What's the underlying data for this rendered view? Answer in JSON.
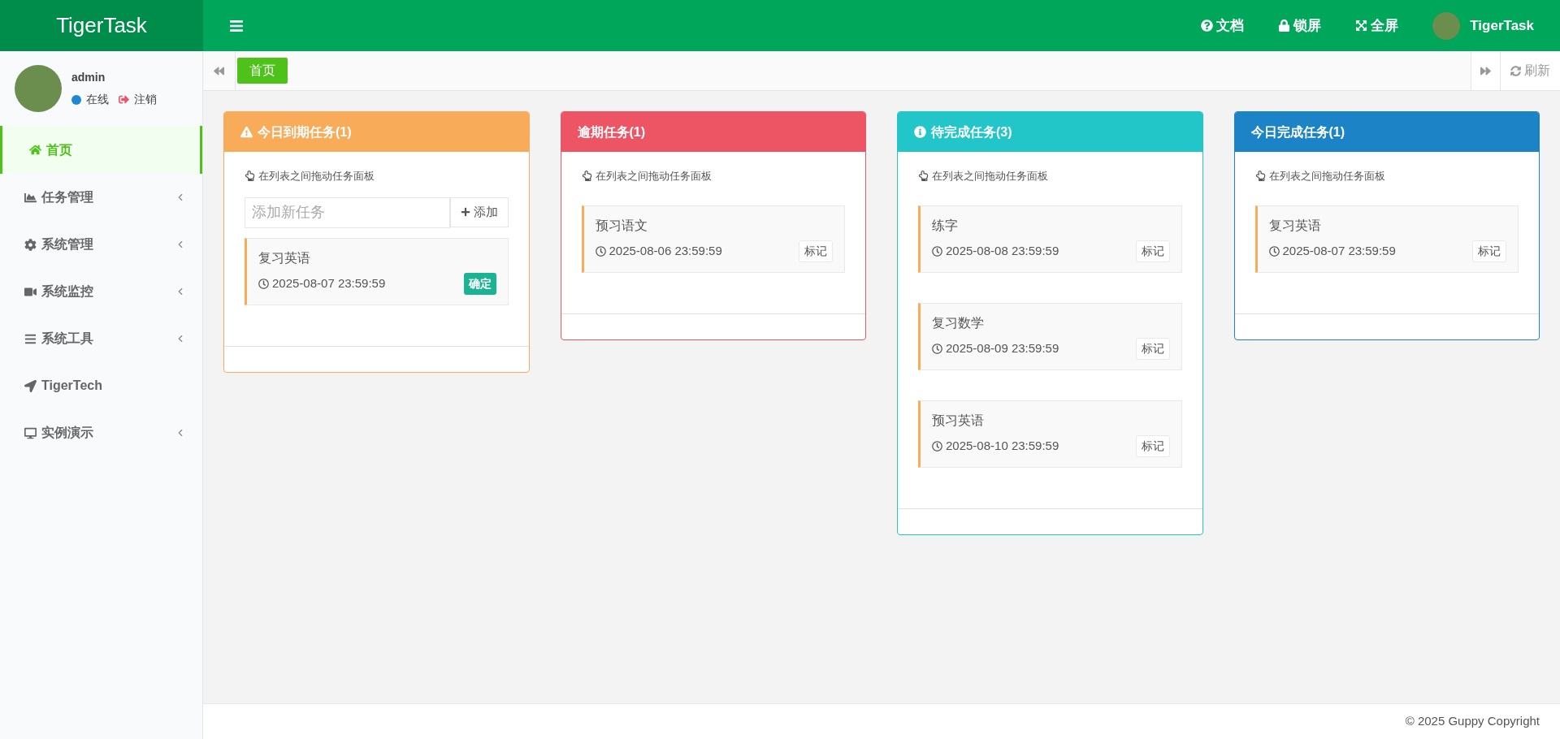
{
  "brand": "TigerTask",
  "header": {
    "links": [
      {
        "kind": "help",
        "label": "文档"
      },
      {
        "kind": "lock",
        "label": "锁屏"
      },
      {
        "kind": "fullscreen",
        "label": "全屏"
      }
    ],
    "user": "TigerTask"
  },
  "sidebar": {
    "user": {
      "name": "admin",
      "status": "在线",
      "logout": "注销"
    },
    "items": [
      {
        "kind": "home",
        "label": "首页",
        "selected": true,
        "has_children": false
      },
      {
        "kind": "tasks",
        "label": "任务管理",
        "selected": false,
        "has_children": true
      },
      {
        "kind": "system",
        "label": "系统管理",
        "selected": false,
        "has_children": true
      },
      {
        "kind": "monitor",
        "label": "系统监控",
        "selected": false,
        "has_children": true
      },
      {
        "kind": "tools",
        "label": "系统工具",
        "selected": false,
        "has_children": true
      },
      {
        "kind": "link",
        "label": "TigerTech",
        "selected": false,
        "has_children": false
      },
      {
        "kind": "demo",
        "label": "实例演示",
        "selected": false,
        "has_children": true
      }
    ]
  },
  "tabs": [
    {
      "label": "首页",
      "selected": true
    }
  ],
  "refresh": "刷新",
  "columns": [
    {
      "title": "今日到期任务(1)",
      "kind": "warning",
      "color": "#f8ac59",
      "hint": "在列表之间拖动任务面板",
      "input": {
        "placeholder": "添加新任务",
        "button": "添加"
      },
      "tasks": [
        {
          "title": "复习英语",
          "time": "2025-08-07 23:59:59",
          "action": {
            "kind": "confirm",
            "label": "确定"
          }
        }
      ]
    },
    {
      "title": "逾期任务(1)",
      "kind": "plain",
      "color": "#ed5565",
      "hint": "在列表之间拖动任务面板",
      "tasks": [
        {
          "title": "预习语文",
          "time": "2025-08-06 23:59:59",
          "action": {
            "kind": "mark",
            "label": "标记"
          }
        }
      ]
    },
    {
      "title": "待完成任务(3)",
      "kind": "info",
      "color": "#23c6c8",
      "hint": "在列表之间拖动任务面板",
      "tasks": [
        {
          "title": "练字",
          "time": "2025-08-08 23:59:59",
          "action": {
            "kind": "mark",
            "label": "标记"
          }
        },
        {
          "title": "复习数学",
          "time": "2025-08-09 23:59:59",
          "action": {
            "kind": "mark",
            "label": "标记"
          }
        },
        {
          "title": "预习英语",
          "time": "2025-08-10 23:59:59",
          "action": {
            "kind": "mark",
            "label": "标记"
          }
        }
      ]
    },
    {
      "title": "今日完成任务(1)",
      "kind": "plain",
      "color": "#1c84c6",
      "hint": "在列表之间拖动任务面板",
      "tasks": [
        {
          "title": "复习英语",
          "time": "2025-08-07 23:59:59",
          "action": {
            "kind": "mark",
            "label": "标记"
          }
        }
      ]
    }
  ],
  "footer": "© 2025 Guppy Copyright"
}
